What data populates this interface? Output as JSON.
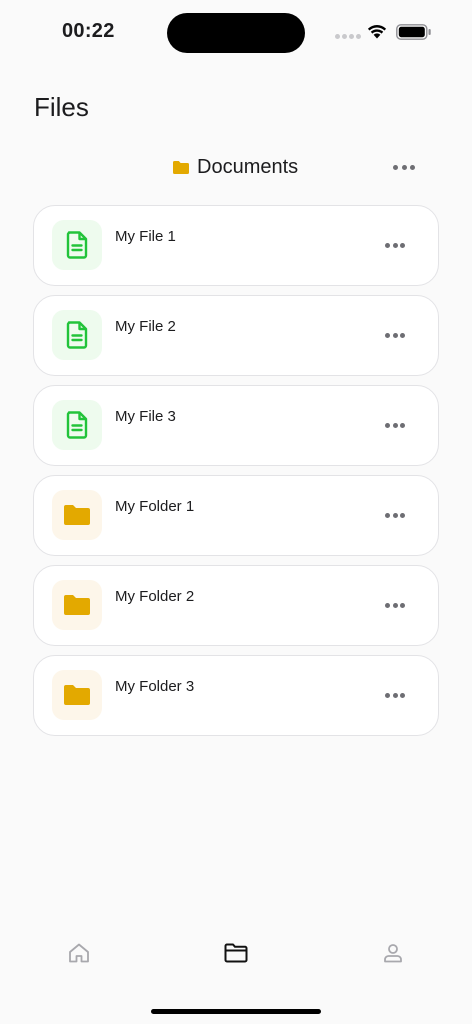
{
  "status_bar": {
    "time": "00:22"
  },
  "header": {
    "title": "Files"
  },
  "folder": {
    "name": "Documents"
  },
  "items": [
    {
      "label": "My File 1",
      "type": "file"
    },
    {
      "label": "My File 2",
      "type": "file"
    },
    {
      "label": "My File 3",
      "type": "file"
    },
    {
      "label": "My Folder 1",
      "type": "folder"
    },
    {
      "label": "My Folder 2",
      "type": "folder"
    },
    {
      "label": "My Folder 3",
      "type": "folder"
    }
  ],
  "icons": {
    "file": "document-icon",
    "folder": "folder-icon",
    "more": "ellipsis-icon",
    "tabs": [
      "home-icon",
      "folder-icon",
      "profile-icon"
    ]
  },
  "colors": {
    "file_accent": "#22c33a",
    "folder_accent": "#e3a900",
    "active_tab": "#111111",
    "inactive_tab": "#a8a8ad"
  }
}
